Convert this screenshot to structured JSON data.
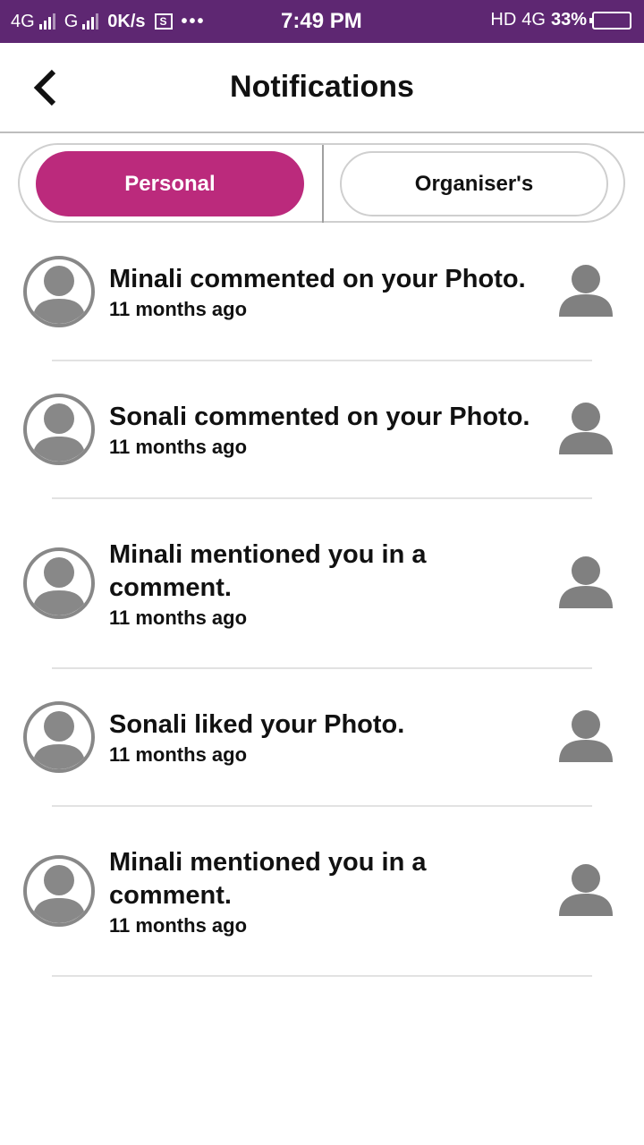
{
  "status_bar": {
    "network1": "4G",
    "network2": "G",
    "speed": "0K/s",
    "sim_icon_label": "S",
    "dots": "•••",
    "time": "7:49 PM",
    "hd": "HD",
    "net_right": "4G",
    "battery_percent": "33%",
    "battery_level": 0.33
  },
  "header": {
    "back_icon": "chevron-left-icon",
    "title": "Notifications"
  },
  "tabs": [
    {
      "label": "Personal",
      "active": true
    },
    {
      "label": "Organiser's",
      "active": false
    }
  ],
  "accent_color": "#bb2a7c",
  "statusbar_color": "#5e2772",
  "notifications": [
    {
      "message": "Minali commented on your Photo.",
      "time": "11 months ago"
    },
    {
      "message": "Sonali commented on your Photo.",
      "time": "11 months ago"
    },
    {
      "message": "Minali mentioned you in a comment.",
      "time": "11 months ago"
    },
    {
      "message": "Sonali liked your Photo.",
      "time": "11 months ago"
    },
    {
      "message": "Minali mentioned you in a comment.",
      "time": "11 months ago"
    }
  ]
}
